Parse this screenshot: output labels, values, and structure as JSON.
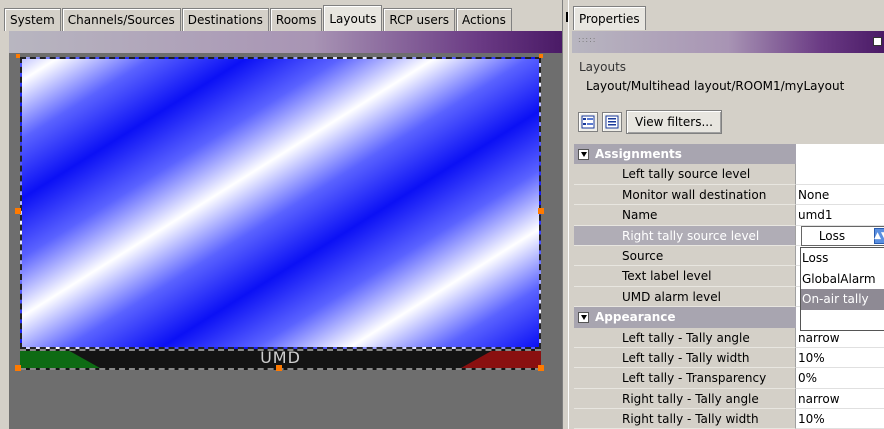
{
  "tabs": [
    {
      "label": "System"
    },
    {
      "label": "Channels/Sources"
    },
    {
      "label": "Destinations"
    },
    {
      "label": "Rooms"
    },
    {
      "label": "Layouts"
    },
    {
      "label": "RCP users"
    },
    {
      "label": "Actions"
    }
  ],
  "active_tab": "Layouts",
  "canvas": {
    "umd_label": "UMD"
  },
  "properties": {
    "tab_label": "Properties",
    "section_label": "Layouts",
    "path": "Layout/Multihead layout/ROOM1/myLayout",
    "view_filters_label": "View filters...",
    "assignments": {
      "label": "Assignments",
      "rows": [
        {
          "name": "Left tally source level",
          "value": ""
        },
        {
          "name": "Monitor wall destination",
          "value": "None"
        },
        {
          "name": "Name",
          "value": "umd1"
        },
        {
          "name": "Right tally source level",
          "value": "Loss"
        },
        {
          "name": "Source",
          "value": ""
        },
        {
          "name": "Text label level",
          "value": ""
        },
        {
          "name": "UMD alarm level",
          "value": ""
        }
      ]
    },
    "appearance": {
      "label": "Appearance",
      "rows": [
        {
          "name": "Left tally - Tally angle",
          "value": "narrow"
        },
        {
          "name": "Left tally - Tally width",
          "value": "10%"
        },
        {
          "name": "Left tally - Transparency",
          "value": "0%"
        },
        {
          "name": "Right tally - Tally angle",
          "value": "narrow"
        },
        {
          "name": "Right tally - Tally width",
          "value": "10%"
        }
      ]
    },
    "dropdown": {
      "selected": "Loss",
      "options": [
        "Loss",
        "GlobalAlarm",
        "On-air tally"
      ],
      "highlighted": "On-air tally"
    }
  }
}
